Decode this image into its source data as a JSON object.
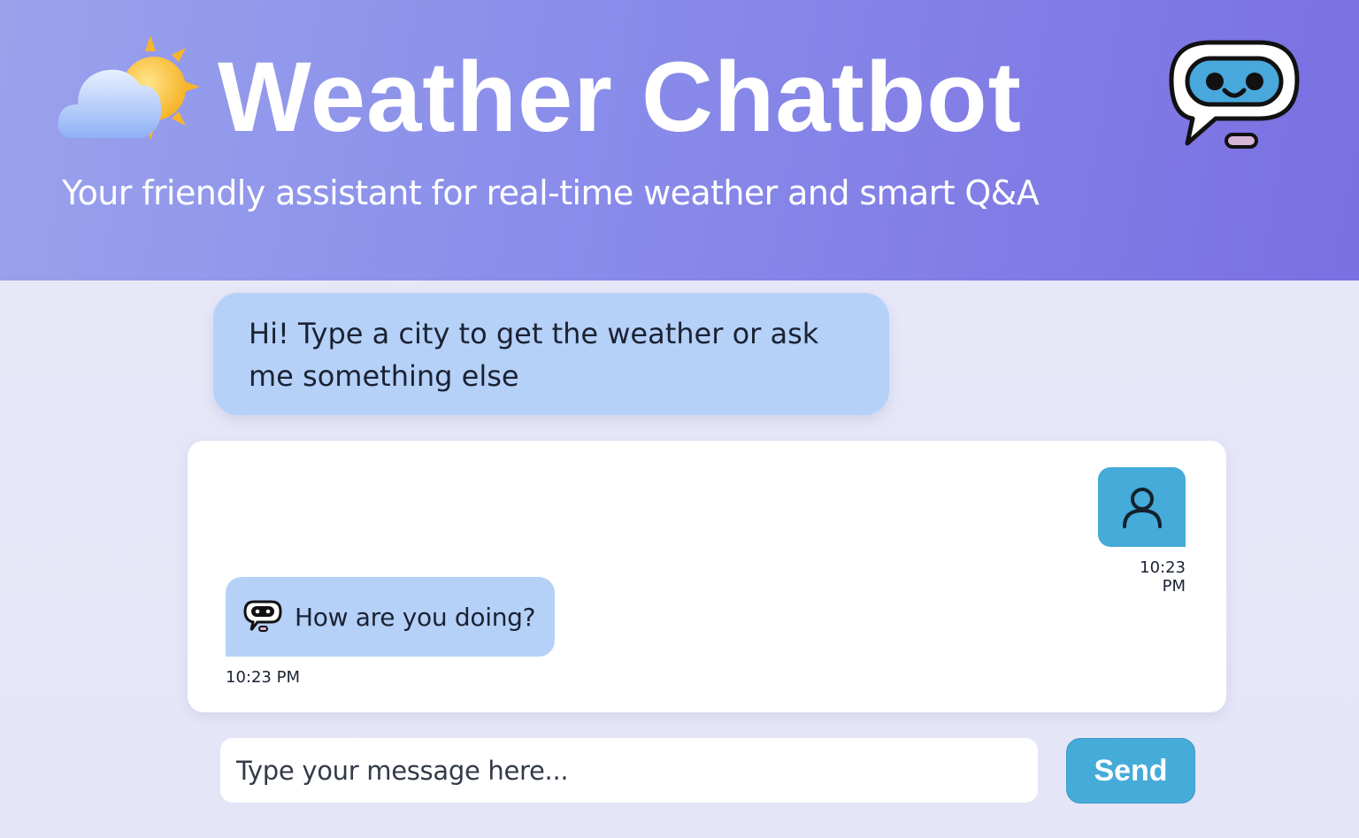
{
  "header": {
    "title": "Weather Chatbot",
    "subtitle": "Your friendly assistant for real-time weather and smart Q&A",
    "weather_icon": "cloud-sun-icon",
    "logo_icon": "robot-chat-icon"
  },
  "greeting": {
    "text": "Hi! Type a city to get the weather or ask me something else"
  },
  "chat": {
    "messages": [
      {
        "sender": "user",
        "avatar_icon": "user-icon",
        "time": "10:23 PM"
      },
      {
        "sender": "bot",
        "avatar_icon": "robot-icon",
        "text": "How are you doing?",
        "time": "10:23 PM"
      }
    ]
  },
  "composer": {
    "placeholder": "Type your message here...",
    "value": "",
    "send_label": "Send"
  },
  "colors": {
    "header_start": "#9aa2ec",
    "header_end": "#7b6fe2",
    "bubble": "#b5d1f8",
    "accent": "#45abd8"
  }
}
